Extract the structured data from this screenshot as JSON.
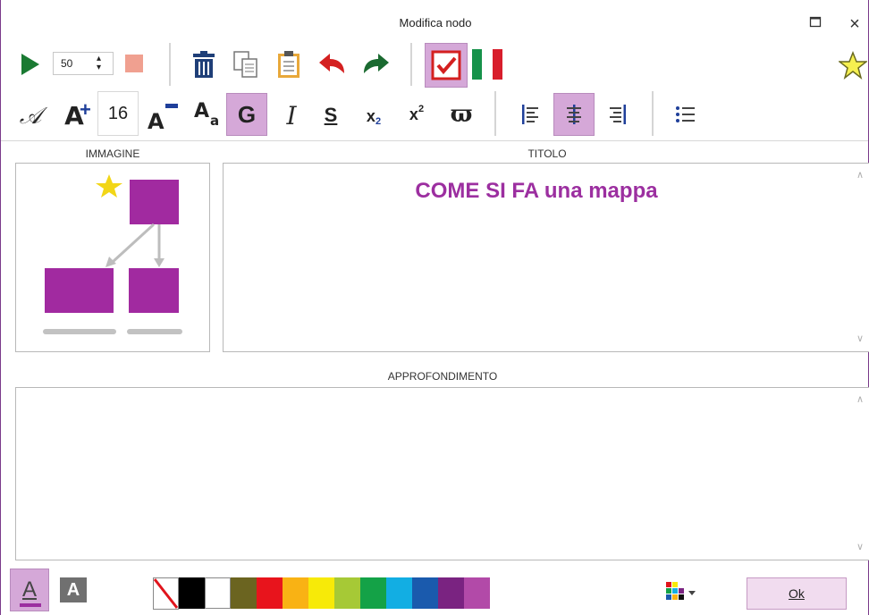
{
  "window": {
    "title": "Modifica nodo",
    "maximize_icon": "maximize-icon",
    "close_icon": "close-icon",
    "close_label": "×"
  },
  "toolbar1": {
    "play_icon": "play-icon",
    "speed_value": "50",
    "stop_icon": "stop-icon",
    "delete_icon": "trash-icon",
    "copy_icon": "copy-icon",
    "paste_icon": "paste-icon",
    "undo_icon": "undo-icon",
    "redo_icon": "redo-icon",
    "check_icon": "checkbox-icon",
    "flag_icon": "italy-flag-icon",
    "favorite_icon": "star-icon"
  },
  "toolbar2": {
    "font_icon": "font-script-icon",
    "font_symbol": "𝒜",
    "grow_label": "A",
    "font_size": "16",
    "shrink_label": "A",
    "case_label_big": "A",
    "case_label_small": "a",
    "bold_label": "G",
    "italic_label": "I",
    "strike_label": "S",
    "subscript_label": "x",
    "subscript_mark": "2",
    "superscript_label": "x",
    "superscript_mark": "2",
    "omega_label": "ϖ",
    "align_left_icon": "align-left-icon",
    "align_center_icon": "align-center-icon",
    "align_right_icon": "align-right-icon",
    "list_icon": "bullet-list-icon"
  },
  "sections": {
    "image_label": "IMMAGINE",
    "title_label": "TITOLO",
    "details_label": "APPROFONDIMENTO"
  },
  "title_text": "COME SI FA una mappa",
  "bottom": {
    "text_color_label": "A",
    "bg_color_label": "A",
    "palette_more_icon": "palette-icon",
    "ok_label": "Ok"
  },
  "colors": {
    "accent": "#9c2fa0",
    "selected_bg": "#d5a8d8",
    "swatches": [
      "#000000",
      "#ffffff",
      "#6b6420",
      "#e8141c",
      "#f9b214",
      "#f7ea08",
      "#a6c936",
      "#14a247",
      "#12aee3",
      "#1a5aad",
      "#7a2381",
      "#b24aa8"
    ]
  }
}
